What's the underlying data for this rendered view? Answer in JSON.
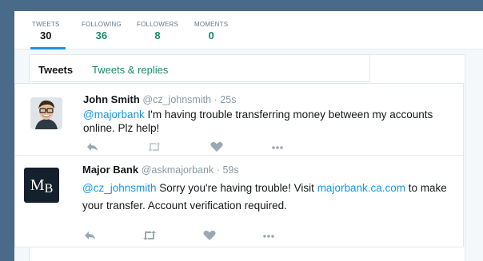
{
  "stats": [
    {
      "label": "TWEETS",
      "value": "30"
    },
    {
      "label": "FOLLOWING",
      "value": "36"
    },
    {
      "label": "FOLLOWERS",
      "value": "8"
    },
    {
      "label": "MOMENTS",
      "value": "0"
    }
  ],
  "tabs": {
    "tweets": "Tweets",
    "replies": "Tweets & replies"
  },
  "tweet1": {
    "name": "John Smith",
    "handle": "@cz_johnsmith",
    "time": "· 25s",
    "mention": "@majorbank",
    "text_a": " I'm having trouble transferring money between my accounts",
    "text_b": "online. Plz help!"
  },
  "tweet2": {
    "avatar_m": "M",
    "avatar_b": "B",
    "name": "Major Bank",
    "handle": "@askmajorbank",
    "time": "· 59s",
    "mention": "@cz_johnsmith",
    "text_a": " Sorry you're having trouble! Visit ",
    "link": "majorbank.ca.com",
    "text_b": " to make",
    "text_c": "your transfer. Account verification required."
  },
  "colors": {
    "accent": "#1b95e0",
    "green": "#1b8a6b",
    "icon": "#9aa8b4"
  }
}
